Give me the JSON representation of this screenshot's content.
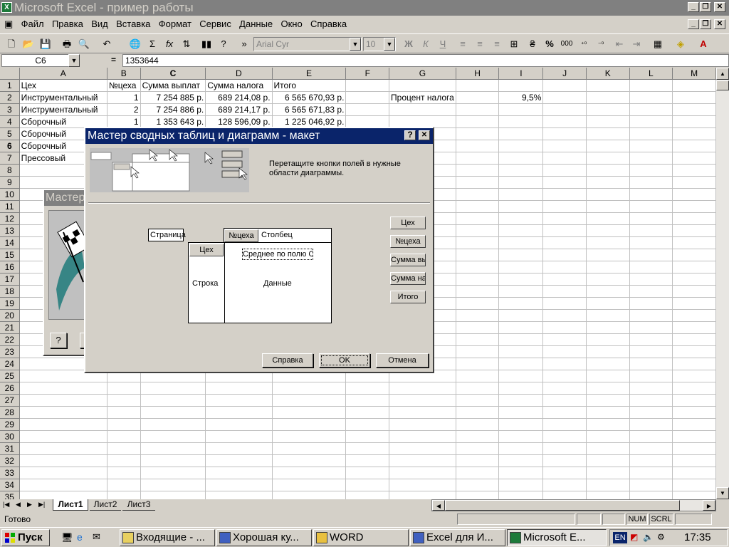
{
  "app": {
    "title": "Microsoft Excel - пример работы",
    "icon": "excel-icon"
  },
  "menu": [
    "Файл",
    "Правка",
    "Вид",
    "Вставка",
    "Формат",
    "Сервис",
    "Данные",
    "Окно",
    "Справка"
  ],
  "toolbar": {
    "font": "Arial Cyr",
    "size": "10",
    "bold": "Ж",
    "italic": "К",
    "underline": "Ч",
    "percent": "%",
    "thousands": "000",
    "sigma": "Σ",
    "fx": "fx",
    "more": "»"
  },
  "formula": {
    "cell": "C6",
    "eq": "=",
    "value": "1353644"
  },
  "sheet": {
    "columns": [
      "A",
      "B",
      "C",
      "D",
      "E",
      "F",
      "G",
      "H",
      "I",
      "J",
      "K",
      "L",
      "M"
    ],
    "rows": [
      [
        "Цех",
        "№цеха",
        "Сумма выплат",
        "Сумма налога",
        "Итого",
        "",
        "",
        "",
        ""
      ],
      [
        "Инструментальный",
        "1",
        "7 254 885 р.",
        "689 214,08 р.",
        "6 565 670,93 р.",
        "",
        "Процент налога",
        "",
        "9,5%"
      ],
      [
        "Инструментальный",
        "2",
        "7 254 886 р.",
        "689 214,17 р.",
        "6 565 671,83 р.",
        "",
        "",
        "",
        ""
      ],
      [
        "Сборочный",
        "1",
        "1 353 643 р.",
        "128 596,09 р.",
        "1 225 046,92 р.",
        "",
        "",
        "",
        ""
      ],
      [
        "Сборочный",
        "",
        "",
        "",
        "",
        "",
        "",
        "",
        ""
      ],
      [
        "Сборочный",
        "",
        "",
        "",
        "",
        "",
        "",
        "",
        ""
      ],
      [
        "Прессовый",
        "",
        "",
        "",
        "",
        "",
        "",
        "",
        ""
      ]
    ],
    "row_count": 35,
    "tabs": [
      "Лист1",
      "Лист2",
      "Лист3"
    ],
    "active_tab": "Лист1"
  },
  "status": {
    "ready": "Готово",
    "num": "NUM",
    "scrl": "SCRL"
  },
  "dialog": {
    "title": "Мастер сводных таблиц и диаграмм - макет",
    "help_q": "?",
    "close": "✕",
    "instruction": "Перетащите кнопки полей в нужные области диаграммы.",
    "page_label": "Страница",
    "col_field": "№цеха",
    "col_label": "Столбец",
    "row_field": "Цех",
    "row_label": "Строка",
    "data_field": "Среднее по полю С",
    "data_label": "Данные",
    "fields": [
      "Цех",
      "№цеха",
      "Сумма вь",
      "Сумма на",
      "Итого"
    ],
    "btn_help": "Справка",
    "btn_ok": "OK",
    "btn_cancel": "Отмена"
  },
  "bgwizard": {
    "title": "Мастер",
    "help": "?"
  },
  "taskbar": {
    "start": "Пуск",
    "tasks": [
      "Входящие - ...",
      "Хорошая ку...",
      "WORD",
      "Excel для И...",
      "Microsoft E..."
    ],
    "lang": "EN",
    "clock": "17:35"
  }
}
